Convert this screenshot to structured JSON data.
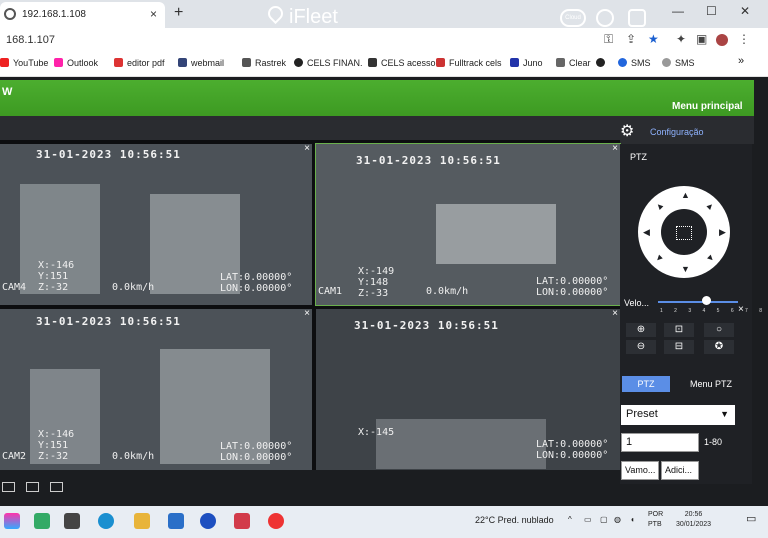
{
  "browser": {
    "tab_title": "192.168.1.108",
    "url": "168.1.107",
    "bookmarks": [
      "YouTube",
      "Outlook",
      "editor pdf",
      "webmail",
      "Rastrek",
      "CELS FINAN.",
      "CELS acesso",
      "Fulltrack cels",
      "Juno",
      "Clear",
      "SMS",
      "SMS"
    ],
    "more": "»",
    "new_tab": "+",
    "close": "×"
  },
  "app": {
    "name": "iFleet",
    "header_left": "W",
    "cloud_label": "Cloud",
    "menu_principal": "Menu principal",
    "configuracao": "Configuração"
  },
  "cameras": [
    {
      "ts": "31-01-2023 10:56:51",
      "xyz": [
        "X:-146",
        "Y:151",
        "Z:-32"
      ],
      "cam": "CAM4",
      "speed": "0.0km/h",
      "lat": "LAT:0.00000°",
      "lon": "LON:0.00000°"
    },
    {
      "ts": "31-01-2023 10:56:51",
      "xyz": [
        "X:-149",
        "Y:148",
        "Z:-33"
      ],
      "cam": "CAM1",
      "speed": "0.0km/h",
      "lat": "LAT:0.00000°",
      "lon": "LON:0.00000°"
    },
    {
      "ts": "31-01-2023 10:56:51",
      "xyz": [
        "X:-146",
        "Y:151",
        "Z:-32"
      ],
      "cam": "CAM2",
      "speed": "0.0km/h",
      "lat": "LAT:0.00000°",
      "lon": "LON:0.00000°"
    },
    {
      "ts": "31-01-2023 10:56:51",
      "xyz": [
        "X:-145",
        "",
        ""
      ],
      "cam": "",
      "speed": "",
      "lat": "LAT:0.00000°",
      "lon": "LON:0.00000°"
    }
  ],
  "ptz": {
    "title": "PTZ",
    "velocity_label": "Velo...",
    "velocity_level": 0.6,
    "ticks": "1 2 3 4 5 6 7 8",
    "tabs": [
      "PTZ",
      "Menu PTZ"
    ],
    "preset": "Preset",
    "preset_number": "1",
    "range": "1-80",
    "btn_go": "Vamo...",
    "btn_add": "Adici..."
  },
  "taskbar": {
    "weather": "22°C  Pred. nublado",
    "lang_top": "POR",
    "lang_bottom": "PTB",
    "time": "20:56",
    "date": "30/01/2023"
  }
}
